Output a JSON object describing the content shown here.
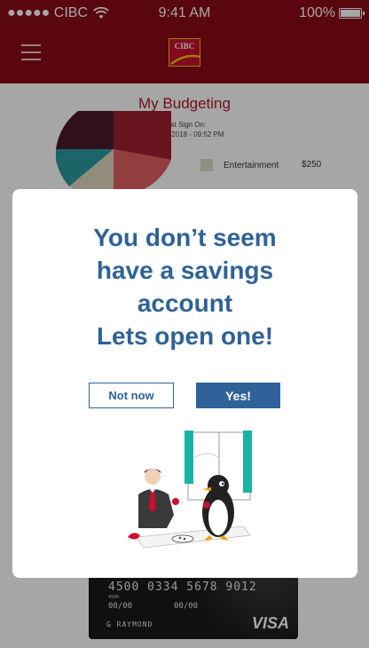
{
  "status_bar": {
    "signal": "●●●●● CIBC",
    "time": "9:41 AM",
    "battery": "100%"
  },
  "header": {
    "logo_text": "CIBC"
  },
  "page": {
    "title": "My Budgeting",
    "last_sign_label": "Last Sign On:",
    "last_sign_date": "Dec 7th 2018 - 09:52 PM"
  },
  "budget_legend": [
    {
      "label": "Entertainment",
      "amount": "$250"
    }
  ],
  "card": {
    "number": "4500 0334 5678 9012",
    "bin": "4500",
    "exp_start": "00/00",
    "exp_end": "00/00",
    "holder": "G RAYMOND",
    "brand": "VISA"
  },
  "modal": {
    "heading_line1": "You don’t seem",
    "heading_line2": "have a savings",
    "heading_line3": "account",
    "heading_line4": "Lets open one!",
    "not_now_label": "Not now",
    "yes_label": "Yes!"
  },
  "colors": {
    "brand_red": "#8a0a16",
    "accent_blue": "#2e6299"
  }
}
